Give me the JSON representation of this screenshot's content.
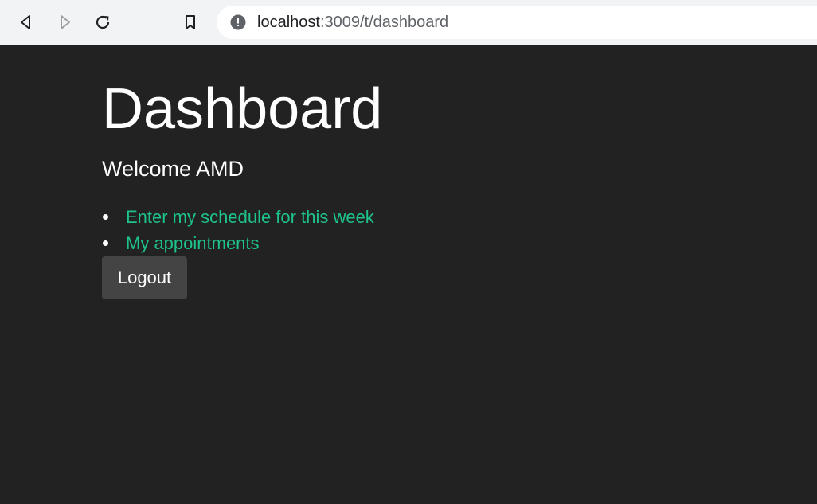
{
  "browser": {
    "url_host": "localhost",
    "url_path": ":3009/t/dashboard",
    "icons": {
      "back": "back-arrow-icon",
      "forward": "forward-arrow-icon",
      "reload": "reload-icon",
      "bookmark": "bookmark-icon",
      "site_info": "info-icon"
    }
  },
  "page": {
    "title": "Dashboard",
    "welcome_prefix": "Welcome ",
    "user_name": "AMD",
    "menu": [
      {
        "label": "Enter my schedule for this week"
      },
      {
        "label": "My appointments"
      }
    ],
    "logout_label": "Logout"
  },
  "colors": {
    "background": "#222222",
    "link": "#1ec28b",
    "button": "#444444",
    "text": "#ffffff"
  }
}
